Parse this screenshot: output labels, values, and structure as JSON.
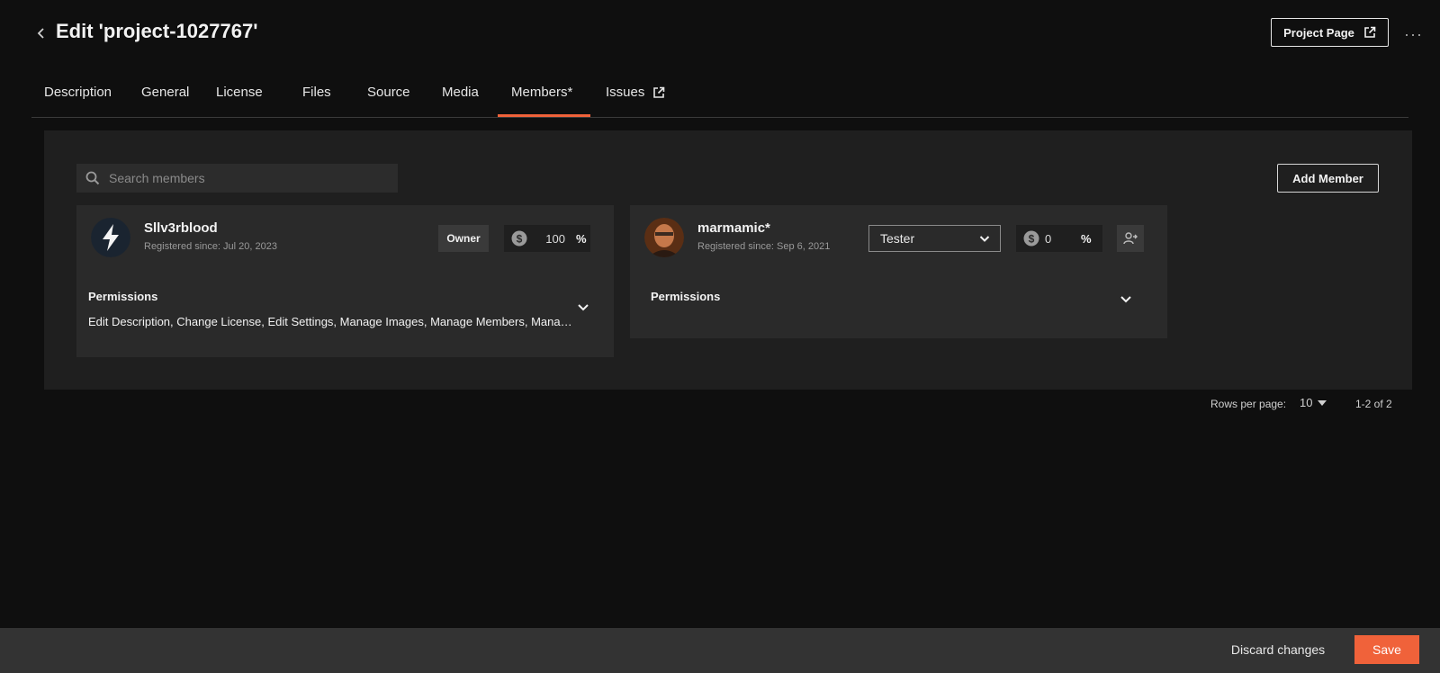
{
  "header": {
    "title": "Edit 'project-1027767'",
    "project_page_label": "Project Page"
  },
  "tabs": [
    {
      "label": "Description"
    },
    {
      "label": "General"
    },
    {
      "label": "License"
    },
    {
      "label": "Files"
    },
    {
      "label": "Source"
    },
    {
      "label": "Media"
    },
    {
      "label": "Members*",
      "active": true
    },
    {
      "label": "Issues"
    }
  ],
  "search": {
    "placeholder": "Search members"
  },
  "add_member_label": "Add Member",
  "members": [
    {
      "name": "Sllv3rblood",
      "since": "Registered since: Jul 20, 2023",
      "role": "Owner",
      "share": "100",
      "share_unit": "%",
      "permissions_label": "Permissions",
      "permissions": "Edit Description, Change License, Edit Settings, Manage Images, Manage Members, Manage Files, Manage Issues"
    },
    {
      "name": "marmamic*",
      "since": "Registered since: Sep 6, 2021",
      "role": "Tester",
      "share": "0",
      "share_unit": "%",
      "permissions_label": "Permissions"
    }
  ],
  "pagination": {
    "rows_label": "Rows per page:",
    "rows_value": "10",
    "range": "1-2 of 2"
  },
  "footer": {
    "discard_label": "Discard changes",
    "save_label": "Save"
  },
  "colors": {
    "accent": "#f0623a",
    "background": "#0f0f0f",
    "panel": "#1f1f1f",
    "card": "#2a2a2a"
  }
}
